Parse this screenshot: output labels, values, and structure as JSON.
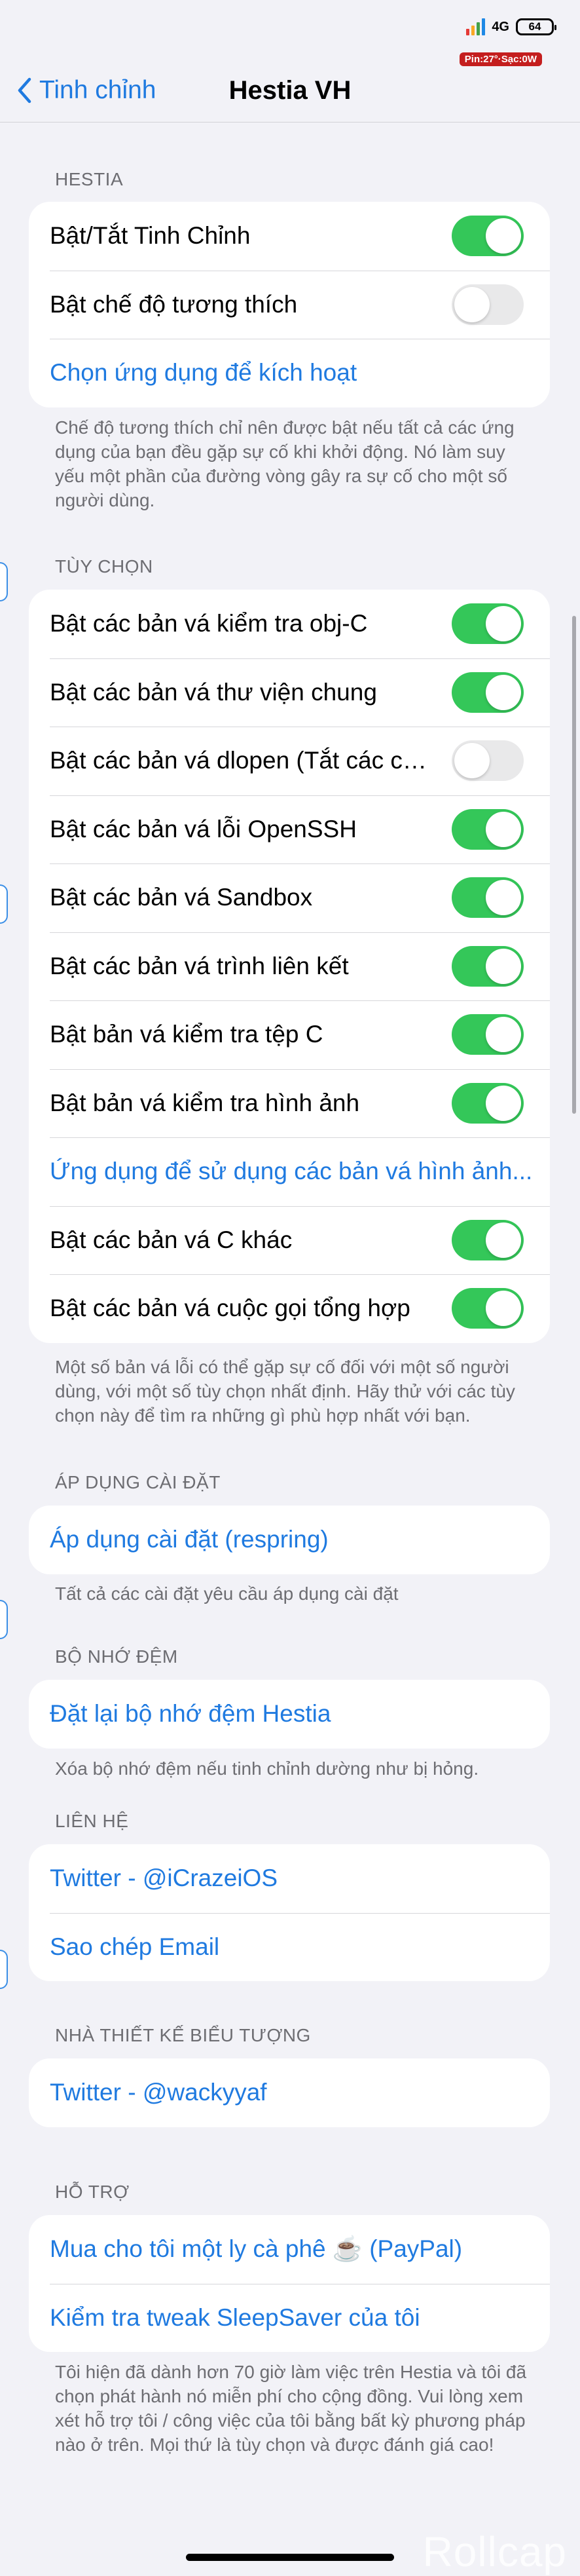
{
  "status": {
    "network": "4G",
    "battery": "64",
    "tag": "Pin:27°·Sạc:0W"
  },
  "nav": {
    "back_label": "Tinh chỉnh",
    "title": "Hestia VH"
  },
  "hestia": {
    "header": "HESTIA",
    "rows": [
      {
        "label": "Bật/Tắt Tinh Chỉnh",
        "toggle": true
      },
      {
        "label": "Bật chế độ tương thích",
        "toggle": false
      },
      {
        "label": "Chọn ứng dụng để kích hoạt",
        "link": true
      }
    ],
    "footer": "Chế độ tương thích chỉ nên được bật nếu tất cả các ứng dụng của bạn đều gặp sự cố khi khởi động. Nó làm suy yếu một phần của đường vòng gây ra sự cố cho một số người dùng."
  },
  "options": {
    "header": "TÙY CHỌN",
    "rows": [
      {
        "label": "Bật các bản vá kiểm tra obj-C",
        "toggle": true
      },
      {
        "label": "Bật các bản vá thư viện chung",
        "toggle": true
      },
      {
        "label": "Bật các bản vá dlopen (Tắt các chỉ...",
        "toggle": false
      },
      {
        "label": "Bật các bản vá lỗi OpenSSH",
        "toggle": true
      },
      {
        "label": "Bật các bản vá Sandbox",
        "toggle": true
      },
      {
        "label": "Bật các bản vá trình liên kết",
        "toggle": true
      },
      {
        "label": "Bật bản vá kiểm tra tệp C",
        "toggle": true
      },
      {
        "label": "Bật bản vá kiểm tra hình ảnh",
        "toggle": true
      },
      {
        "label": "Ứng dụng để sử dụng các bản vá hình ảnh...",
        "link": true
      },
      {
        "label": "Bật các bản vá C khác",
        "toggle": true
      },
      {
        "label": "Bật các bản vá cuộc gọi tổng hợp",
        "toggle": true
      }
    ],
    "footer": "Một số bản vá lỗi có thể gặp sự cố đối với một số người dùng, với một số tùy chọn nhất định. Hãy thử với các tùy chọn này để tìm ra những gì phù hợp nhất với bạn."
  },
  "apply": {
    "header": "ÁP DỤNG CÀI ĐẶT",
    "rows": [
      {
        "label": "Áp dụng cài đặt (respring)",
        "link": true
      }
    ],
    "footer": "Tất cả các cài đặt yêu cầu áp dụng cài đặt"
  },
  "cache": {
    "header": "BỘ NHỚ ĐỆM",
    "rows": [
      {
        "label": "Đặt lại bộ nhớ đệm Hestia",
        "link": true
      }
    ],
    "footer": "Xóa bộ nhớ đệm nếu tinh chỉnh dường như bị hỏng."
  },
  "contact": {
    "header": "LIÊN HỆ",
    "rows": [
      {
        "label": "Twitter - @iCrazeiOS",
        "link": true
      },
      {
        "label": "Sao chép Email",
        "link": true
      }
    ]
  },
  "icon_designer": {
    "header": "NHÀ THIẾT KẾ BIỂU TƯỢNG",
    "rows": [
      {
        "label": "Twitter - @wackyyaf",
        "link": true
      }
    ]
  },
  "support": {
    "header": "HỖ TRỢ",
    "rows": [
      {
        "label": "Mua cho tôi một ly cà phê ☕ (PayPal)",
        "link": true
      },
      {
        "label": "Kiểm tra tweak SleepSaver của tôi",
        "link": true
      }
    ],
    "footer": "Tôi hiện đã dành hơn 70 giờ làm việc trên Hestia và tôi đã chọn phát hành nó miễn phí cho cộng đồng. Vui lòng xem xét hỗ trợ tôi / công việc của tôi bằng bất kỳ phương pháp nào ở trên. Mọi thứ là tùy chọn và được đánh giá cao!"
  },
  "watermark": "Rollcap",
  "colors": {
    "accent": "#1f7ae0",
    "toggle_on": "#34c759",
    "toggle_off": "#e9e9ea",
    "background": "#f2f2f7"
  }
}
